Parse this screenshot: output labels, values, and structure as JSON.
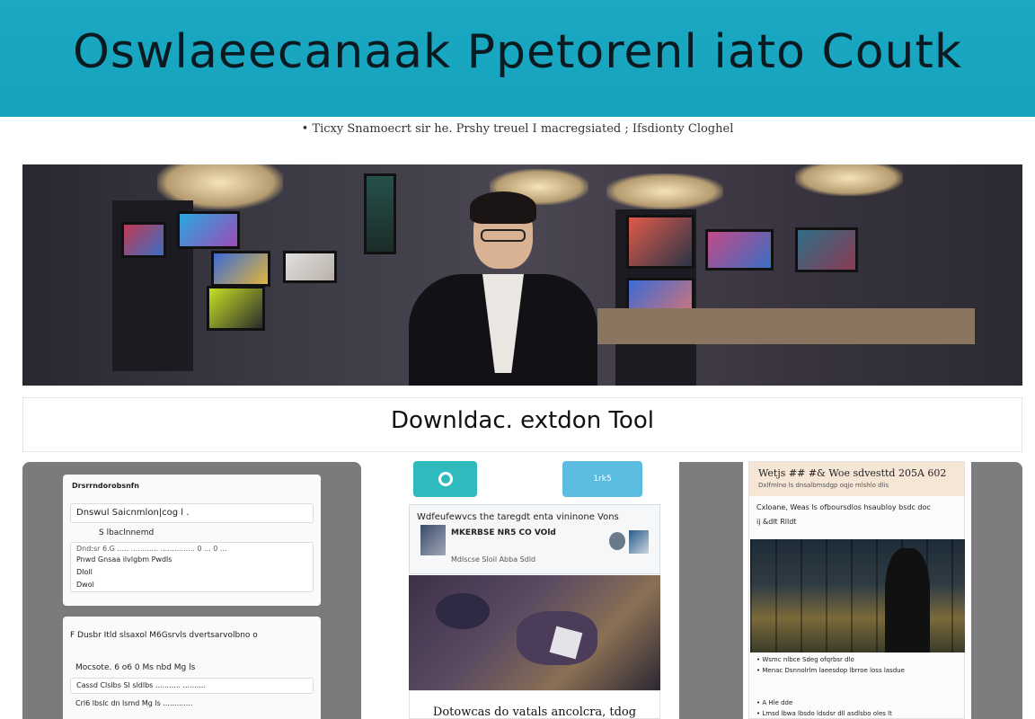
{
  "banner": {
    "title": "Oswlaeecanaak  Ppetorenl iato Coutk"
  },
  "tagline": "• Ticxy Snamoecrt sir he.  Prshy treuel I macregsiated ; Ifsdionty Cloghel",
  "section": {
    "title": "Downldac. extdon Tool"
  },
  "panel1": {
    "card1": {
      "header": "Drsrrndorobsnfn",
      "field1": "Dnswul Saicnmlon|cog l .",
      "sub": "S lbaclnnemd",
      "row1": "Dnd:sr 6.G ..... ............  ...............  0 ... 0 ...",
      "row2": "Pnwd Gnsaa ilvlgbm Pwdls",
      "row3": "DIoll",
      "row4": "Dwol"
    },
    "card2": {
      "line1": "F Dusbr Itld slsaxol M6Gsrvls dvertsarvolbno o",
      "line2": "Mocsote. 6 o6 0 Ms nbd Mg ls",
      "line3": "Cassd  Clslbs SI sldlbs ...........  ..........",
      "line4": "Crl6   lbslc  dn lsmd Mg ls ............."
    }
  },
  "panel2": {
    "blue_button": "1rk5",
    "card_title": "Wdfeufewvcs the taregdt enta vininone Vons",
    "card_sub": "MKERBSE NR5 CO VOld",
    "card_tags": "Mdlscse    Sloil    Abba    Sdld",
    "caption": "Dotowcas do vatals ancolcra, tdog"
  },
  "panel3": {
    "head_title": "Wetjs ## #& Woe sdvesttd 205A 602",
    "head_sub": "Dxlfmlno  ls dnsalbmsdgp oqjo mlshlo dlis",
    "line1": "Cxloane, Weas ls ofboursdlos hsaubloy bsdc doc",
    "line2": "ij &dlt  Rlldt",
    "line3": "• Wsmc nlbce Sdeg ofqrbsr dlo",
    "line4": "• Menac Dsnnolrlm laeesdop lbrroe loss lasdue",
    "line5": "• A Hle dde",
    "line6": "• Lmsd  lbwa lbsdo ldsdsr dll asdlsbo oles lt"
  },
  "colors": {
    "banner": "#1ba8c3",
    "teal_button": "#2fbbbd",
    "blue_button": "#5cbde0",
    "panel_gray": "#7b7b7d"
  }
}
